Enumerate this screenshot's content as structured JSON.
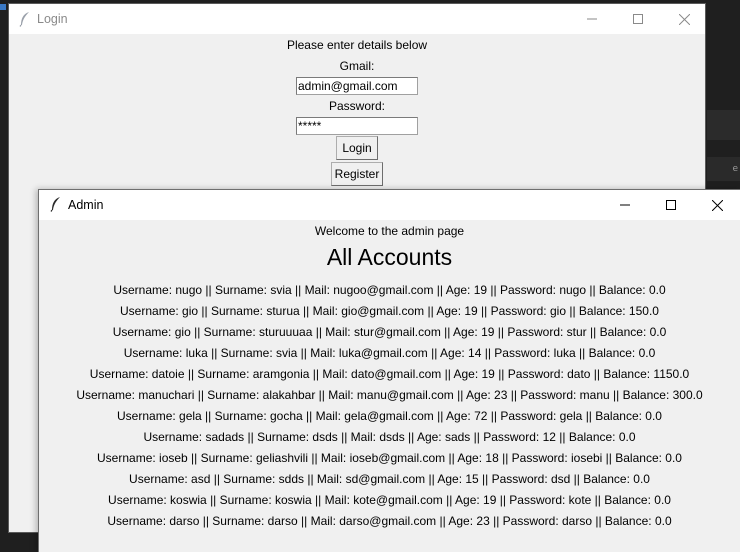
{
  "login_window": {
    "title": "Login",
    "prompt": "Please enter details below",
    "gmail_label": "Gmail:",
    "gmail_value": "admin@gmail.com",
    "password_label": "Password:",
    "password_value": "*****",
    "login_button": "Login",
    "register_button": "Register"
  },
  "admin_window": {
    "title": "Admin",
    "welcome": "Welcome to the admin page",
    "heading": "All Accounts",
    "accounts": [
      "Username: nugo || Surname: svia || Mail: nugoo@gmail.com || Age: 19 || Password: nugo || Balance: 0.0",
      "Username: gio || Surname: sturua || Mail: gio@gmail.com || Age: 19 || Password: gio || Balance: 150.0",
      "Username: gio || Surname: sturuuuaa || Mail: stur@gmail.com || Age: 19 || Password: stur || Balance: 0.0",
      "Username: luka || Surname: svia || Mail: luka@gmail.com || Age: 14 || Password: luka || Balance: 0.0",
      "Username: datoie || Surname: aramgonia || Mail: dato@gmail.com || Age: 19 || Password: dato || Balance: 1150.0",
      "Username: manuchari || Surname: alakahbar || Mail: manu@gmail.com || Age: 23 || Password: manu || Balance: 300.0",
      "Username: gela || Surname: gocha || Mail: gela@gmail.com || Age: 72 || Password: gela || Balance: 0.0",
      "Username: sadads || Surname: dsds || Mail: dsds || Age: sads || Password: 12 || Balance: 0.0",
      "Username: ioseb || Surname: geliashvili || Mail: ioseb@gmail.com || Age: 18 || Password: iosebi || Balance: 0.0",
      "Username: asd || Surname: sdds || Mail: sd@gmail.com || Age: 15 || Password: dsd || Balance: 0.0",
      "Username: koswia || Surname: koswia || Mail: kote@gmail.com || Age: 19 || Password: kote || Balance: 0.0",
      "Username: darso || Surname: darso || Mail: darso@gmail.com || Age: 23 || Password: darso || Balance: 0.0"
    ]
  },
  "background_fragment": "e"
}
